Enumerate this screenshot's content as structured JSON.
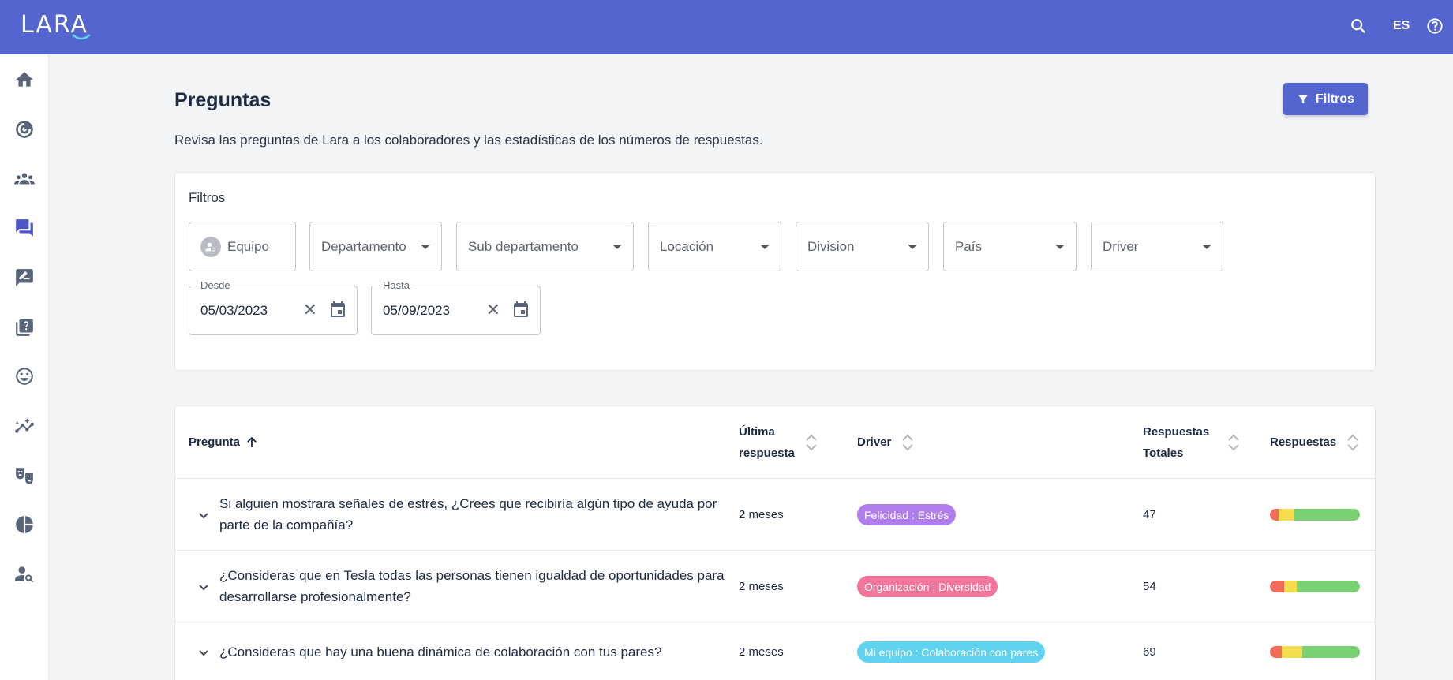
{
  "app": {
    "logo": "LARA",
    "language": "ES"
  },
  "colors": {
    "primary": "#5565d0",
    "red": "#f26b5b",
    "yellow": "#f5dc4c",
    "green": "#79d173"
  },
  "icons": {
    "top": [
      "search-icon",
      "help-icon"
    ],
    "sidebar": [
      "home-icon",
      "radar-icon",
      "groups-icon",
      "forum-icon",
      "rate-review-icon",
      "quiz-icon",
      "smile-icon",
      "insights-icon",
      "theater-masks-icon",
      "pie-chart-icon",
      "manage-search-user-icon"
    ]
  },
  "page": {
    "title": "Preguntas",
    "description": "Revisa las preguntas de Lara a los colaboradores y las estadísticas de los números de respuestas.",
    "filter_button": "Filtros"
  },
  "filters": {
    "title": "Filtros",
    "team": "Equipo",
    "department": "Departamento",
    "sub_department": "Sub departamento",
    "location": "Locación",
    "division": "Division",
    "country": "País",
    "driver": "Driver",
    "from_label": "Desde",
    "from_value": "05/03/2023",
    "to_label": "Hasta",
    "to_value": "05/09/2023",
    "clear_symbol": "✕"
  },
  "table": {
    "headers": {
      "question": "Pregunta",
      "last_response_line1": "Última",
      "last_response_line2": "respuesta",
      "driver": "Driver",
      "total_line1": "Respuestas",
      "total_line2": "Totales",
      "responses": "Respuestas"
    },
    "rows": [
      {
        "question": "Si alguien mostrara señales de estrés, ¿Crees que recibiría algún tipo de ayuda por parte de la compañía?",
        "last": "2 meses",
        "driver": "Felicidad : Estrés",
        "driver_color": "#b07ded",
        "total": "47",
        "distribution": [
          0.1,
          0.17,
          0.73
        ]
      },
      {
        "question": "¿Consideras que en Tesla todas las personas tienen igualdad de oportunidades para desarrollarse profesionalmente?",
        "last": "2 meses",
        "driver": "Organización : Diversidad",
        "driver_color": "#f2759a",
        "total": "54",
        "distribution": [
          0.16,
          0.14,
          0.7
        ]
      },
      {
        "question": "¿Consideras que hay una buena dinámica de colaboración con tus pares?",
        "last": "2 meses",
        "driver": "Mi equipo : Colaboración con pares",
        "driver_color": "#5fd3f0",
        "total": "69",
        "distribution": [
          0.13,
          0.23,
          0.64
        ]
      }
    ]
  }
}
